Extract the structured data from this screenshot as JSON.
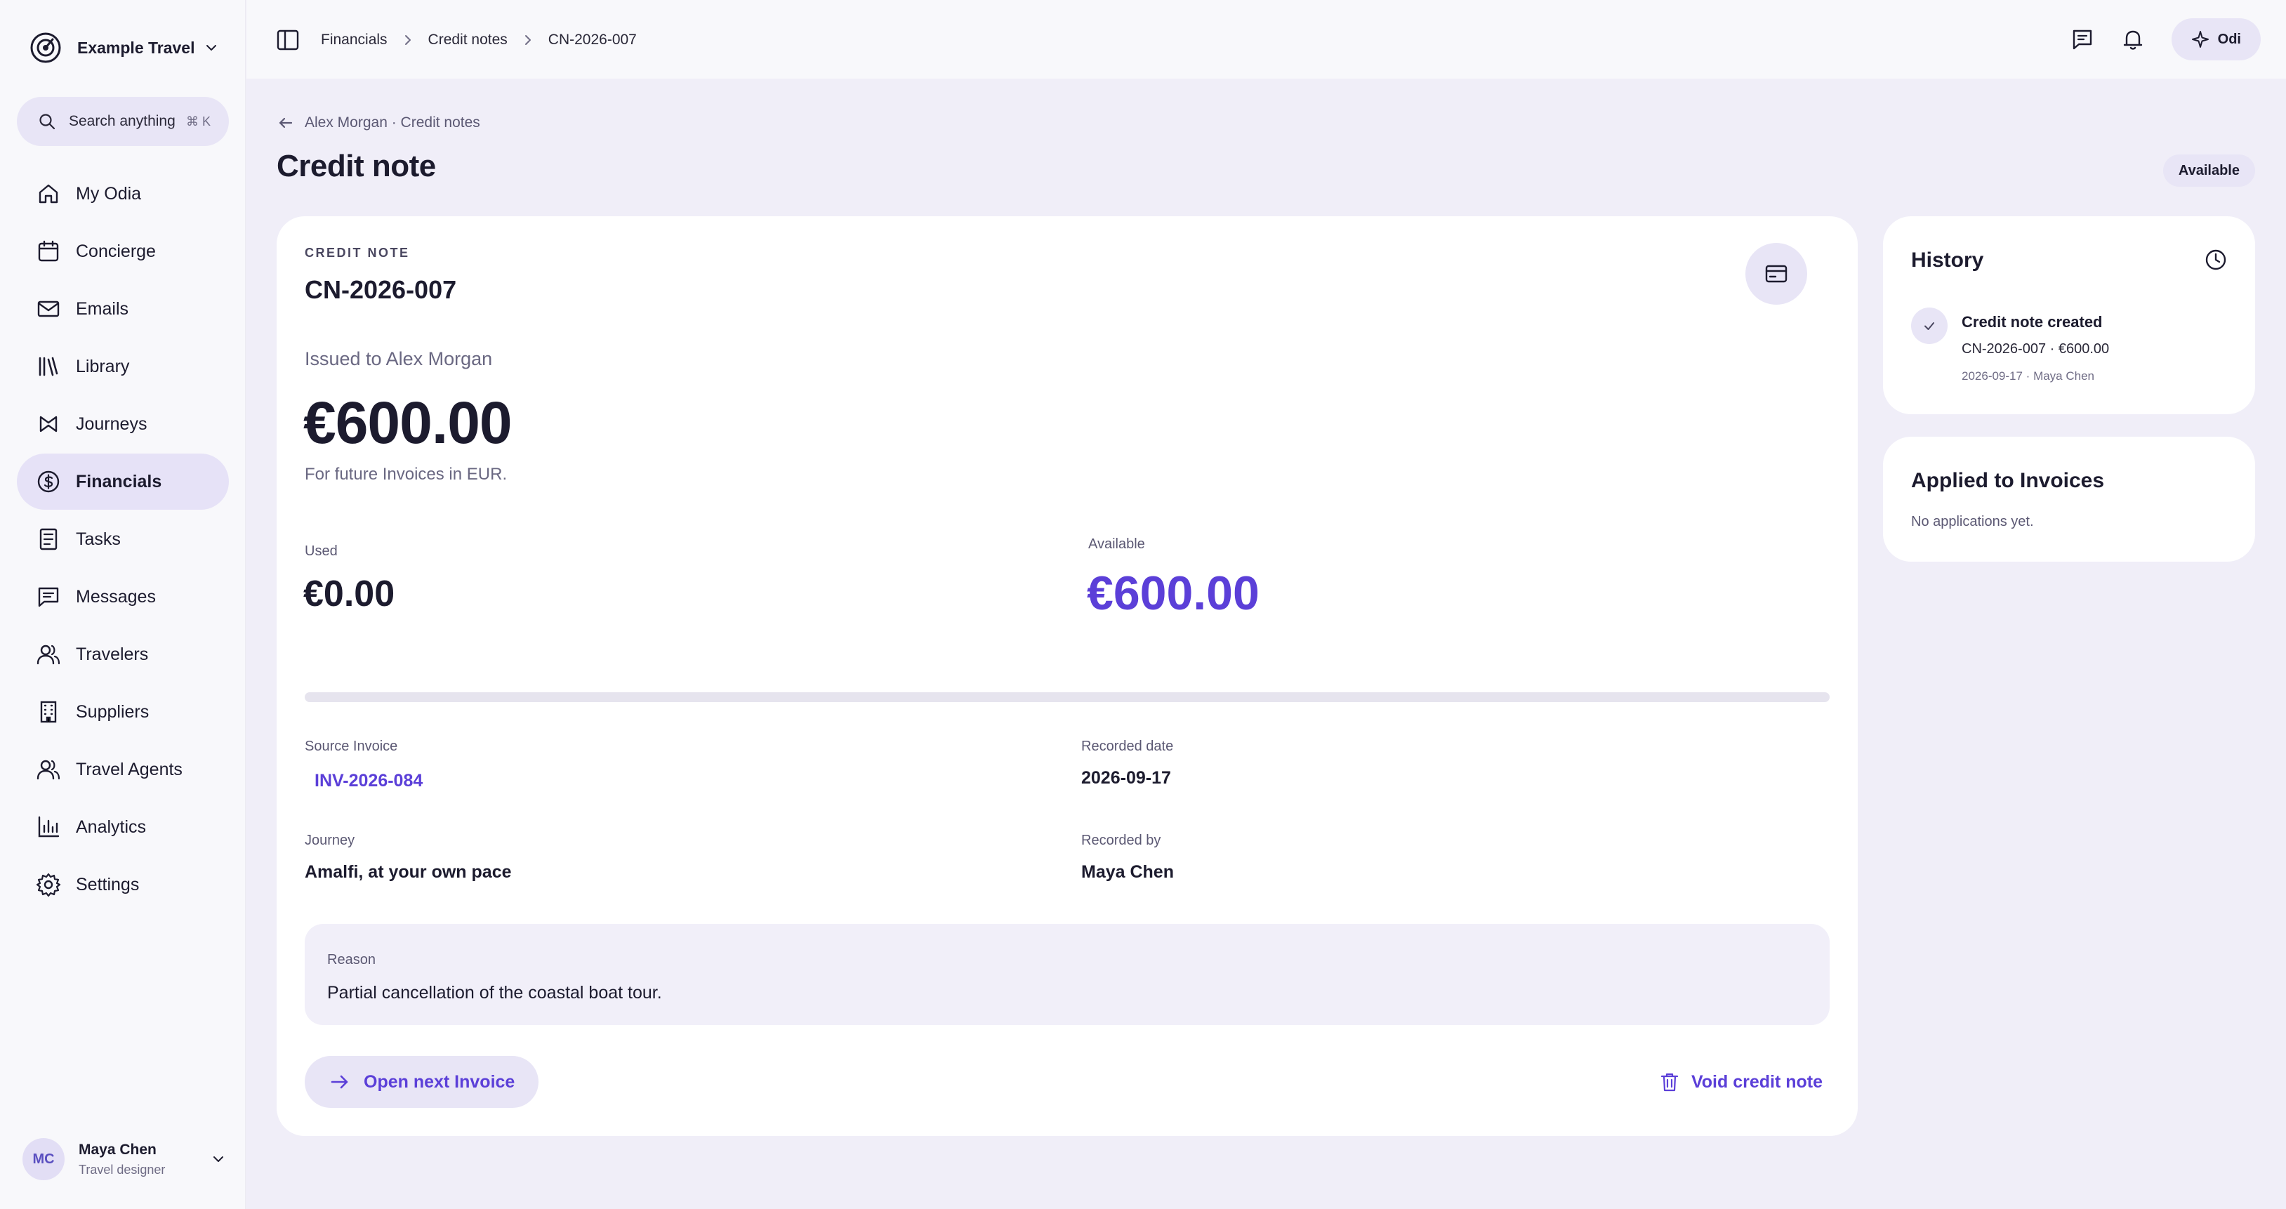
{
  "brand": {
    "name": "Example Travel",
    "logo_icon": "target-logo-icon"
  },
  "search": {
    "label": "Search anything",
    "shortcut": "⌘ K"
  },
  "sidebar": {
    "items": [
      {
        "label": "My Odia",
        "icon": "home-icon",
        "active": false
      },
      {
        "label": "Concierge",
        "icon": "calendar-icon",
        "active": false
      },
      {
        "label": "Emails",
        "icon": "mail-icon",
        "active": false
      },
      {
        "label": "Library",
        "icon": "library-icon",
        "active": false
      },
      {
        "label": "Journeys",
        "icon": "journeys-icon",
        "active": false
      },
      {
        "label": "Financials",
        "icon": "dollar-icon",
        "active": true
      },
      {
        "label": "Tasks",
        "icon": "tasks-icon",
        "active": false
      },
      {
        "label": "Messages",
        "icon": "message-icon",
        "active": false
      },
      {
        "label": "Travelers",
        "icon": "users-icon",
        "active": false
      },
      {
        "label": "Suppliers",
        "icon": "building-icon",
        "active": false
      },
      {
        "label": "Travel Agents",
        "icon": "users-icon",
        "active": false
      },
      {
        "label": "Analytics",
        "icon": "chart-icon",
        "active": false
      },
      {
        "label": "Settings",
        "icon": "gear-icon",
        "active": false
      }
    ]
  },
  "user": {
    "initials": "MC",
    "name": "Maya Chen",
    "role": "Travel designer"
  },
  "breadcrumb": [
    "Financials",
    "Credit notes",
    "CN-2026-007"
  ],
  "topbar": {
    "assistant_label": "Odi"
  },
  "page": {
    "back_link": "Alex Morgan · Credit notes",
    "title": "Credit note",
    "status": "Available"
  },
  "credit_note": {
    "eyebrow": "CREDIT NOTE",
    "number": "CN-2026-007",
    "issued_to": "Issued to Alex Morgan",
    "amount": "€600.00",
    "amount_note": "For future Invoices in EUR.",
    "used_label": "Used",
    "used_value": "€0.00",
    "available_label": "Available",
    "available_value": "€600.00",
    "used_fraction": 0,
    "fields": {
      "source_invoice_label": "Source Invoice",
      "source_invoice_value": "INV-2026-084",
      "recorded_date_label": "Recorded date",
      "recorded_date_value": "2026-09-17",
      "journey_label": "Journey",
      "journey_value": "Amalfi, at your own pace",
      "recorded_by_label": "Recorded by",
      "recorded_by_value": "Maya Chen"
    },
    "reason_label": "Reason",
    "reason_text": "Partial cancellation of the coastal boat tour.",
    "primary_action": "Open next Invoice",
    "void_action": "Void credit note"
  },
  "history": {
    "title": "History",
    "events": [
      {
        "title": "Credit note created",
        "detail": "CN-2026-007 · €600.00",
        "meta": "2026-09-17 · Maya Chen"
      }
    ]
  },
  "applied": {
    "title": "Applied to Invoices",
    "empty_text": "No applications yet."
  },
  "colors": {
    "accent": "#5b3fd8",
    "background": "#f0eef8",
    "surface": "#ffffff",
    "pill": "#e8e5f6"
  }
}
